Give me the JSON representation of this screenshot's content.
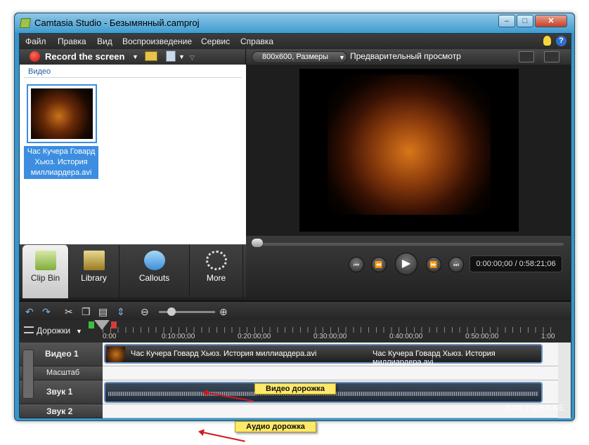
{
  "window": {
    "title": "Camtasia Studio - Безымянный.camproj"
  },
  "menu": [
    "Файл",
    "Правка",
    "Вид",
    "Воспроизведение",
    "Сервис",
    "Справка"
  ],
  "left_toolbar": {
    "record_label": "Record the screen"
  },
  "clip_bin": {
    "section_label": "Видео",
    "clip_caption": "Час Кучера Говард Хьюз. История миллиардера.avi"
  },
  "tabs": [
    "Clip Bin",
    "Library",
    "Callouts",
    "More"
  ],
  "preview": {
    "size_select": "800x600, Размеры",
    "label": "Предварительный просмотр",
    "time": "0:00:00;00 / 0:58:21;06"
  },
  "timeline": {
    "tracks_label": "Дорожки",
    "ruler_ticks": [
      "0:00",
      "0:10:00;00",
      "0:20:00;00",
      "0:30:00;00",
      "0:40:00;00",
      "0:50:00;00",
      "1:00"
    ],
    "lanes": [
      "Видео 1",
      "Масштаб",
      "Звук 1",
      "Звук 2"
    ],
    "video_clip_title": "Час Кучера Говард Хьюз. История миллиардера.avi",
    "video_clip_title_2": "Час Кучера Говард Хьюз. История миллиардера.avi"
  },
  "annotations": {
    "video": "Видео дорожка",
    "audio": "Аудио дорожка"
  },
  "watermark": "SOFT◎BASE"
}
